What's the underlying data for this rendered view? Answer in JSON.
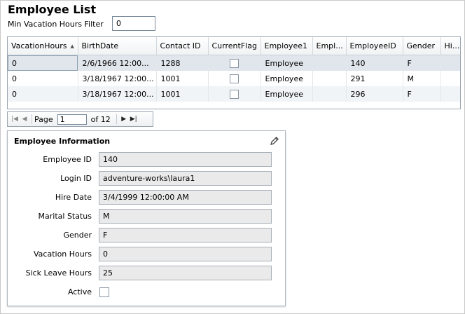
{
  "title": "Employee List",
  "filter": {
    "label": "Min Vacation Hours Filter",
    "value": "0"
  },
  "grid": {
    "columns": [
      "VacationHours",
      "BirthDate",
      "Contact ID",
      "CurrentFlag",
      "Employee1",
      "Empl...",
      "EmployeeID",
      "Gender",
      "Hi..."
    ],
    "rows": [
      [
        "0",
        "2/6/1966 12:00...",
        "1288",
        "",
        "Employee",
        "",
        "140",
        "F",
        ""
      ],
      [
        "0",
        "3/18/1967 12:00...",
        "1001",
        "",
        "Employee",
        "",
        "291",
        "M",
        ""
      ],
      [
        "0",
        "3/18/1967 12:00...",
        "1001",
        "",
        "Employee",
        "",
        "296",
        "F",
        ""
      ]
    ]
  },
  "pager": {
    "page_label": "Page",
    "page_value": "1",
    "of_label": "of 12"
  },
  "panel": {
    "title": "Employee Information",
    "fields": [
      {
        "label": "Employee ID",
        "value": "140"
      },
      {
        "label": "Login ID",
        "value": "adventure-works\\laura1"
      },
      {
        "label": "Hire Date",
        "value": "3/4/1999 12:00:00 AM"
      },
      {
        "label": "Marital Status",
        "value": "M"
      },
      {
        "label": "Gender",
        "value": "F"
      },
      {
        "label": "Vacation Hours",
        "value": "0"
      },
      {
        "label": "Sick Leave Hours",
        "value": "25"
      }
    ],
    "active_label": "Active"
  }
}
